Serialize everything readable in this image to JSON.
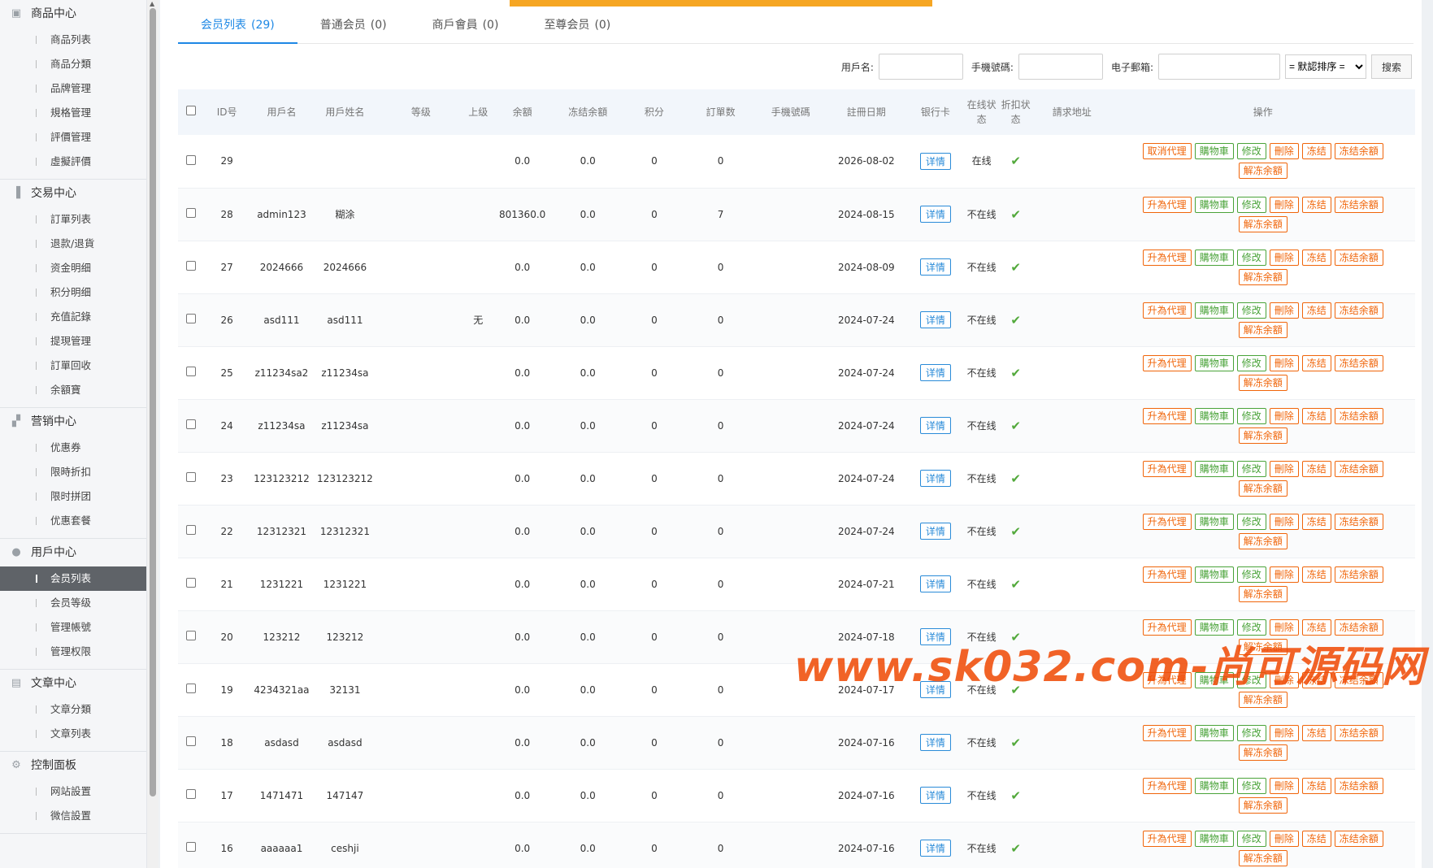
{
  "sidebar": {
    "sections": [
      {
        "title": "商品中心",
        "icon": "goods-icon",
        "items": [
          "商品列表",
          "商品分類",
          "品牌管理",
          "規格管理",
          "評價管理",
          "虛擬評價"
        ]
      },
      {
        "title": "交易中心",
        "icon": "chart-bar-icon",
        "items": [
          "訂單列表",
          "退款/退貨",
          "资金明细",
          "积分明细",
          "充值記錄",
          "提現管理",
          "訂單回收",
          "余額寶"
        ]
      },
      {
        "title": "营销中心",
        "icon": "marketing-icon",
        "items": [
          "优惠券",
          "限時折扣",
          "限时拼团",
          "优惠套餐"
        ]
      },
      {
        "title": "用戶中心",
        "icon": "user-icon",
        "items": [
          "会员列表",
          "会员等级",
          "管理帳號",
          "管理权限"
        ],
        "active_index": 0
      },
      {
        "title": "文章中心",
        "icon": "document-icon",
        "items": [
          "文章分類",
          "文章列表"
        ]
      },
      {
        "title": "控制面板",
        "icon": "gear-icon",
        "items": [
          "网站設置",
          "微信設置"
        ]
      }
    ]
  },
  "tabs": [
    {
      "label": "会员列表",
      "count": "(29)",
      "active": true
    },
    {
      "label": "普通会员",
      "count": "(0)"
    },
    {
      "label": "商戶會員",
      "count": "(0)"
    },
    {
      "label": "至尊会员",
      "count": "(0)"
    }
  ],
  "filters": {
    "username_label": "用戶名:",
    "phone_label": "手機號碼:",
    "email_label": "电子郵箱:",
    "sort_selected": "= 默認排序 =",
    "search_label": "搜索"
  },
  "table": {
    "headers": [
      "ID号",
      "用戶名",
      "用戶姓名",
      "等级",
      "上级",
      "余額",
      "冻结余額",
      "积分",
      "訂單数",
      "手機號碼",
      "註冊日期",
      "银行卡",
      "在线状态",
      "折扣状态",
      "請求地址",
      "操作"
    ],
    "detail_label": "详情",
    "rows": [
      {
        "id": "29",
        "username": "",
        "name": "",
        "superior": "",
        "balance": "0.0",
        "frozen": "0.0",
        "points": "0",
        "orders": "0",
        "date": "2026-08-02",
        "status": "在线",
        "online": true,
        "agent_label": "取消代理"
      },
      {
        "id": "28",
        "username": "admin123",
        "name": "糊涂",
        "superior": "",
        "balance": "801360.0",
        "frozen": "0.0",
        "points": "0",
        "orders": "7",
        "date": "2024-08-15",
        "status": "不在线",
        "online": false,
        "agent_label": "升為代理"
      },
      {
        "id": "27",
        "username": "2024666",
        "name": "2024666",
        "superior": "",
        "balance": "0.0",
        "frozen": "0.0",
        "points": "0",
        "orders": "0",
        "date": "2024-08-09",
        "status": "不在线",
        "online": false,
        "agent_label": "升為代理"
      },
      {
        "id": "26",
        "username": "asd111",
        "name": "asd111",
        "superior": "无",
        "balance": "0.0",
        "frozen": "0.0",
        "points": "0",
        "orders": "0",
        "date": "2024-07-24",
        "status": "不在线",
        "online": false,
        "agent_label": "升為代理"
      },
      {
        "id": "25",
        "username": "z11234sa2",
        "name": "z11234sa",
        "superior": "",
        "balance": "0.0",
        "frozen": "0.0",
        "points": "0",
        "orders": "0",
        "date": "2024-07-24",
        "status": "不在线",
        "online": false,
        "agent_label": "升為代理"
      },
      {
        "id": "24",
        "username": "z11234sa",
        "name": "z11234sa",
        "superior": "",
        "balance": "0.0",
        "frozen": "0.0",
        "points": "0",
        "orders": "0",
        "date": "2024-07-24",
        "status": "不在线",
        "online": false,
        "agent_label": "升為代理"
      },
      {
        "id": "23",
        "username": "123123212",
        "name": "123123212",
        "superior": "",
        "balance": "0.0",
        "frozen": "0.0",
        "points": "0",
        "orders": "0",
        "date": "2024-07-24",
        "status": "不在线",
        "online": false,
        "agent_label": "升為代理"
      },
      {
        "id": "22",
        "username": "12312321",
        "name": "12312321",
        "superior": "",
        "balance": "0.0",
        "frozen": "0.0",
        "points": "0",
        "orders": "0",
        "date": "2024-07-24",
        "status": "不在线",
        "online": false,
        "agent_label": "升為代理"
      },
      {
        "id": "21",
        "username": "1231221",
        "name": "1231221",
        "superior": "",
        "balance": "0.0",
        "frozen": "0.0",
        "points": "0",
        "orders": "0",
        "date": "2024-07-21",
        "status": "不在线",
        "online": false,
        "agent_label": "升為代理"
      },
      {
        "id": "20",
        "username": "123212",
        "name": "123212",
        "superior": "",
        "balance": "0.0",
        "frozen": "0.0",
        "points": "0",
        "orders": "0",
        "date": "2024-07-18",
        "status": "不在线",
        "online": false,
        "agent_label": "升為代理"
      },
      {
        "id": "19",
        "username": "4234321aa",
        "name": "32131",
        "superior": "",
        "balance": "0.0",
        "frozen": "0.0",
        "points": "0",
        "orders": "0",
        "date": "2024-07-17",
        "status": "不在线",
        "online": false,
        "agent_label": "升為代理"
      },
      {
        "id": "18",
        "username": "asdasd",
        "name": "asdasd",
        "superior": "",
        "balance": "0.0",
        "frozen": "0.0",
        "points": "0",
        "orders": "0",
        "date": "2024-07-16",
        "status": "不在线",
        "online": false,
        "agent_label": "升為代理"
      },
      {
        "id": "17",
        "username": "1471471",
        "name": "147147",
        "superior": "",
        "balance": "0.0",
        "frozen": "0.0",
        "points": "0",
        "orders": "0",
        "date": "2024-07-16",
        "status": "不在线",
        "online": false,
        "agent_label": "升為代理"
      },
      {
        "id": "16",
        "username": "aaaaaa1",
        "name": "ceshji",
        "superior": "",
        "balance": "0.0",
        "frozen": "0.0",
        "points": "0",
        "orders": "0",
        "date": "2024-07-16",
        "status": "不在线",
        "online": false,
        "agent_label": "升為代理"
      }
    ],
    "ops": {
      "cart": "購物車",
      "edit": "修改",
      "delete": "刪除",
      "freeze": "冻结",
      "freeze_balance": "冻结余額",
      "unfreeze_balance": "解冻余額"
    }
  },
  "watermark": "www.sk032.com-尚可源码网",
  "colors": {
    "accent": "#1e88e5",
    "orange": "#f0650a",
    "green": "#4aa339",
    "topbar": "#f6a623"
  }
}
